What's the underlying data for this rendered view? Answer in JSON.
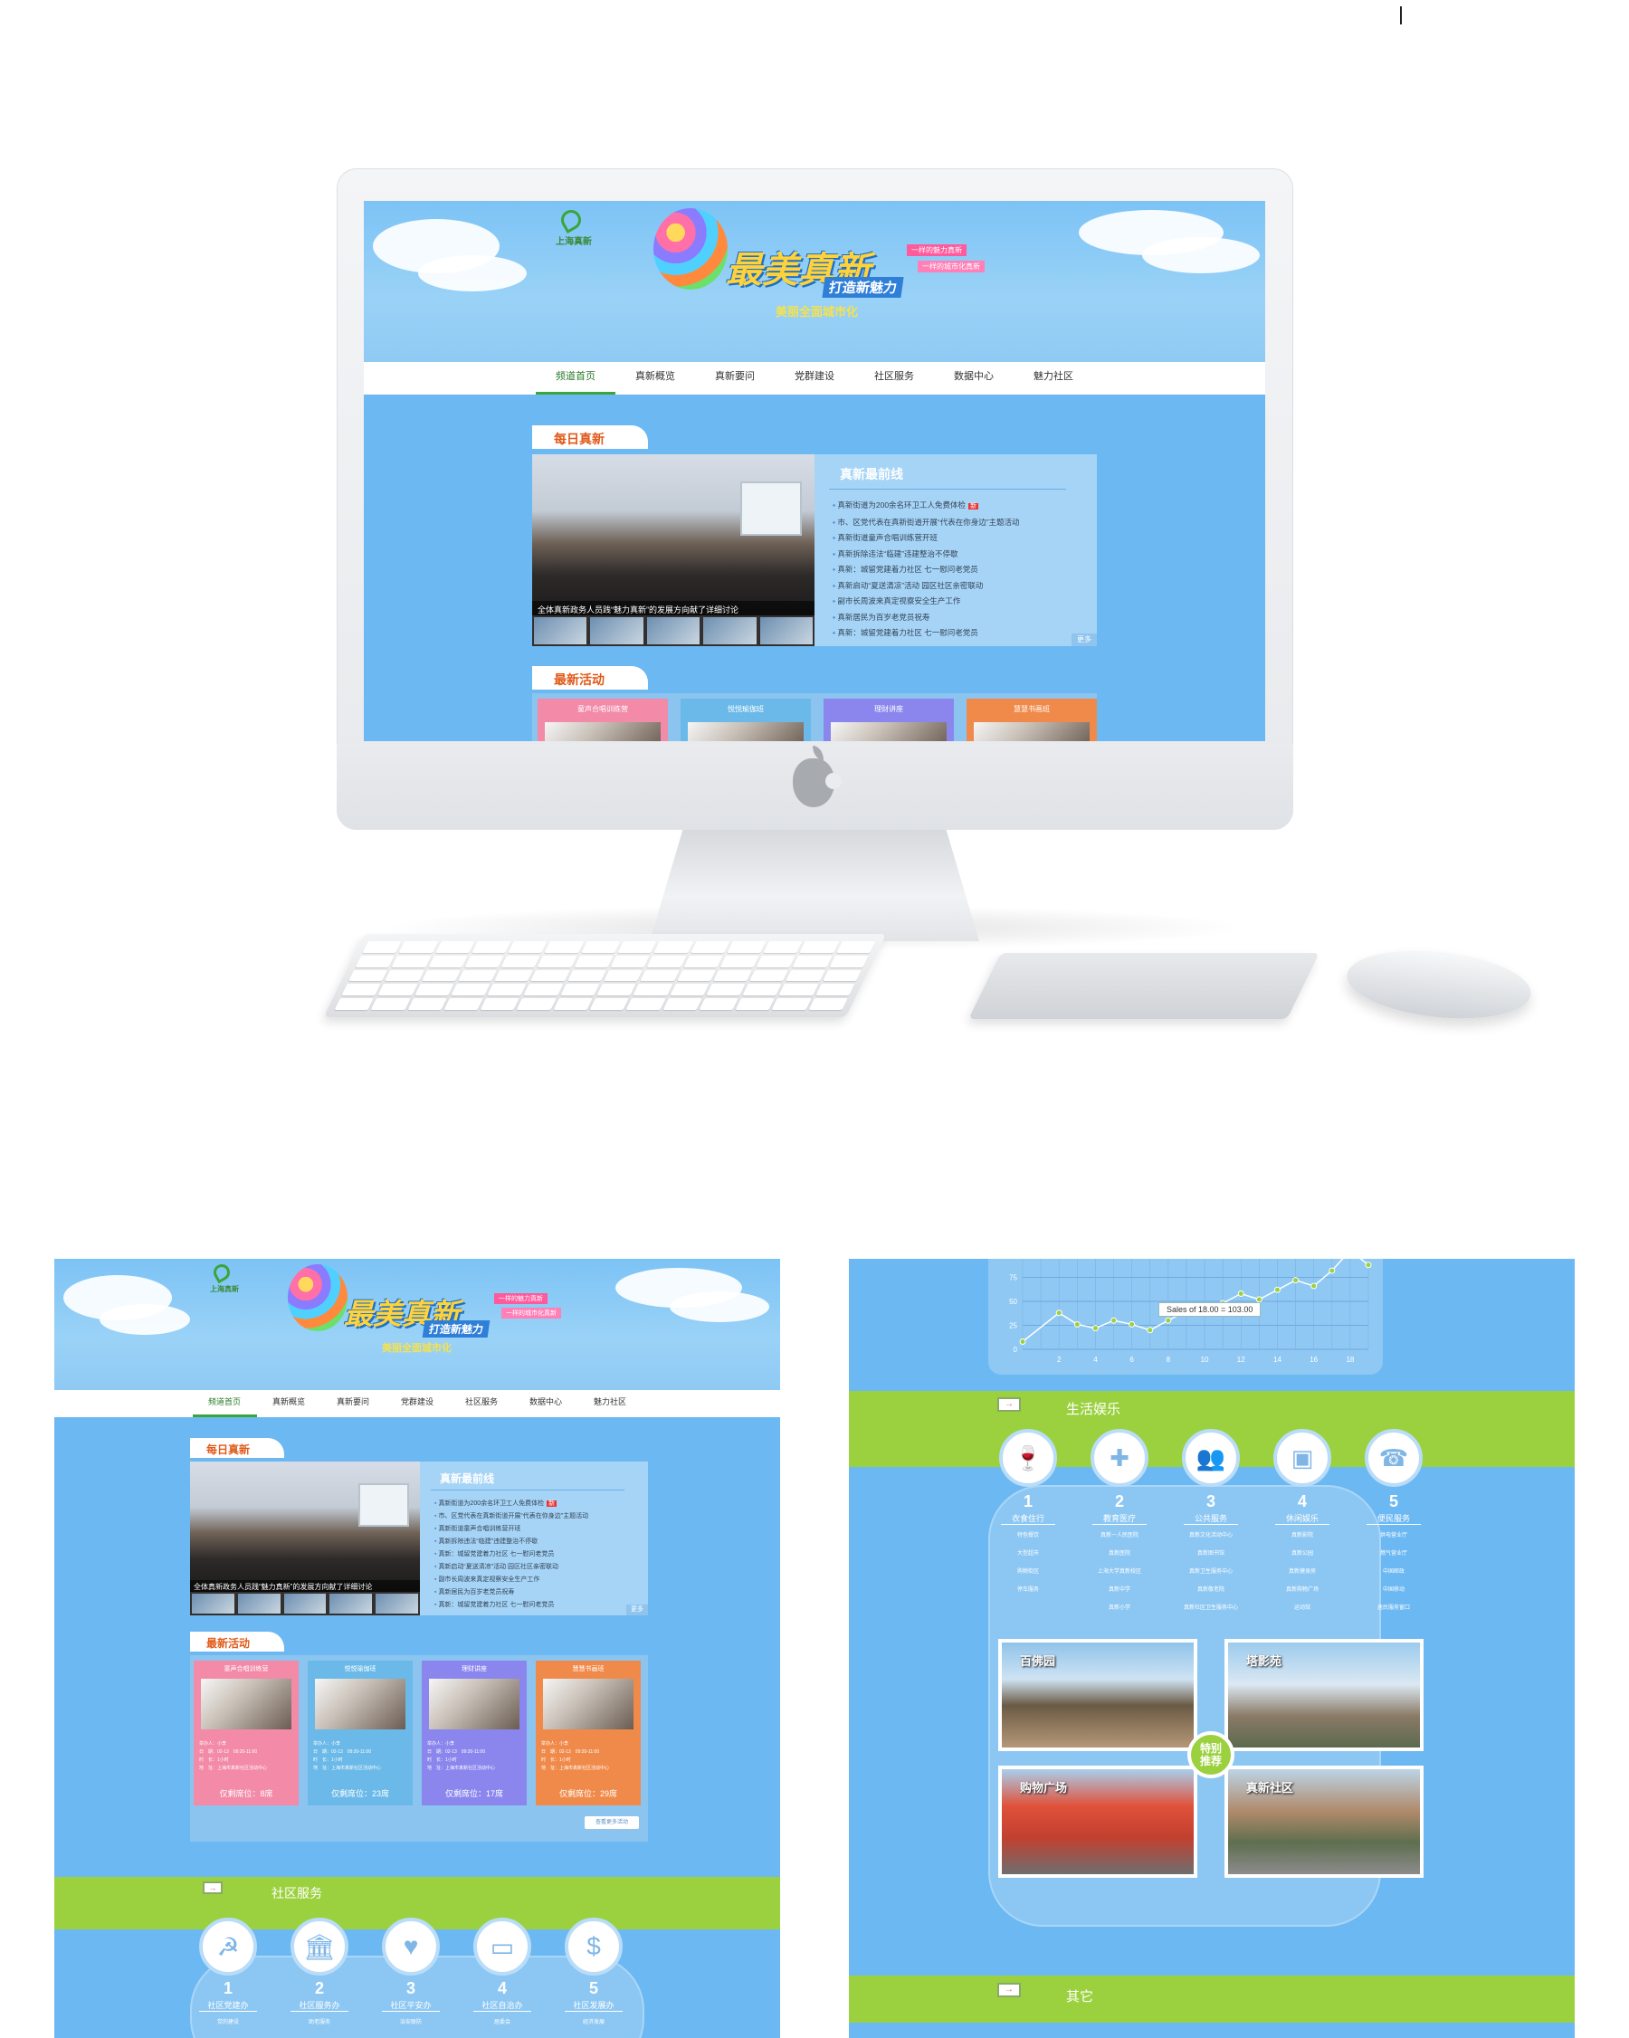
{
  "nav": [
    "频道首页",
    "真新概览",
    "真新要问",
    "党群建设",
    "社区服务",
    "数据中心",
    "魅力社区"
  ],
  "banner": {
    "logo_text": "上海真新",
    "logo_sub": "ZHENXIN",
    "title_main": "最美真新",
    "title_sub": "打造新魅力",
    "tag1": "一样的魅力真新",
    "tag2": "一样的城市化真新",
    "slogan": "美丽全面城市化"
  },
  "daily": {
    "label": "每日真新",
    "caption": "全体真新政务人员践“魅力真新”的发展方向献了详细讨论",
    "news_title": "真新最前线",
    "news": [
      "真新街道为200余名环卫工人免费体检",
      "市、区党代表在真新街道开展“代表在你身边”主题活动",
      "真新街道童声合唱训练营开班",
      "真新拆除违法“临建”违建整治不停歇",
      "真新：城留党建着力社区 七一慰问老党员",
      "真新启动“夏送清凉”活动 园区社区亲密联动",
      "副市长周波来真定视察安全生产工作",
      "真新居民为百岁老党员祝寿",
      "真新：城留党建着力社区 七一慰问老党员"
    ],
    "new_badge": "新",
    "more": "更多"
  },
  "activities": {
    "label": "最新活动",
    "cards": [
      {
        "title": "童声合唱训练营",
        "seats": "仅剩席位：8席",
        "color": "#f28aa8"
      },
      {
        "title": "悦悦瑜伽班",
        "seats": "仅剩席位：23席",
        "color": "#6ab9e8"
      },
      {
        "title": "理财讲座",
        "seats": "仅剩席位：17席",
        "color": "#8a86ee"
      },
      {
        "title": "慧慧书画班",
        "seats": "仅剩席位：29席",
        "color": "#f08a4a"
      }
    ],
    "info_lines": [
      "举办人：小李",
      "日　期：02-13　09:20-11:00",
      "时　长：1小时",
      "地　址：上海市真新社区活动中心"
    ],
    "more_btn": "查看更多活动"
  },
  "community": {
    "label": "社区服务",
    "items": [
      {
        "num": "1",
        "label": "社区党建办",
        "icon": "party-icon",
        "link": "党的建设"
      },
      {
        "num": "2",
        "label": "社区服务办",
        "icon": "bank-icon",
        "link": "助老服务"
      },
      {
        "num": "3",
        "label": "社区平安办",
        "icon": "heart-icon",
        "link": "治安联防"
      },
      {
        "num": "4",
        "label": "社区自治办",
        "icon": "sofa-icon",
        "link": "居委会"
      },
      {
        "num": "5",
        "label": "社区发展办",
        "icon": "money-icon",
        "link": "经济发展"
      }
    ]
  },
  "chart": {
    "tooltip": "Sales of 18.00 = 103.00",
    "y_ticks": [
      "100",
      "75",
      "50",
      "25",
      "0"
    ],
    "x_ticks": [
      "2",
      "4",
      "6",
      "8",
      "10",
      "12",
      "14",
      "16",
      "18"
    ]
  },
  "chart_data": {
    "type": "line",
    "x": [
      0,
      2,
      3,
      4,
      5,
      6,
      7,
      8,
      9,
      10,
      11,
      12,
      13,
      14,
      15,
      16,
      17,
      18,
      19
    ],
    "series": [
      {
        "values": [
          8,
          38,
          26,
          22,
          30,
          26,
          20,
          30,
          40,
          38,
          48,
          58,
          52,
          62,
          72,
          66,
          82,
          103,
          88
        ]
      }
    ],
    "ylim": [
      0,
      100
    ],
    "grid": true
  },
  "life": {
    "label": "生活娱乐",
    "categories": [
      {
        "num": "1",
        "label": "衣食住行",
        "icon": "wineglass-icon",
        "links": [
          "特色餐饮",
          "大型超市",
          "购物街区",
          "停车服务"
        ]
      },
      {
        "num": "2",
        "label": "教育医疗",
        "icon": "medkit-icon",
        "links": [
          "真新一人民医院",
          "真新医院",
          "上海大学真新校区",
          "真新中学",
          "真新小学"
        ]
      },
      {
        "num": "3",
        "label": "公共服务",
        "icon": "people-icon",
        "links": [
          "真新文化活动中心",
          "真新图书馆",
          "真新卫生服务中心",
          "真新敬老院",
          "真新社区卫生服务中心"
        ]
      },
      {
        "num": "4",
        "label": "休闲娱乐",
        "icon": "tv-icon",
        "links": [
          "真新影院",
          "真新公园",
          "真新健身房",
          "真新购物广场",
          "运动馆"
        ]
      },
      {
        "num": "5",
        "label": "便民服务",
        "icon": "phone-icon",
        "links": [
          "供电营业厅",
          "燃气营业厅",
          "中国邮政",
          "中国移动",
          "居民服务窗口"
        ]
      }
    ],
    "places": [
      "百佛园",
      "塔影苑",
      "购物广场",
      "真新社区"
    ],
    "recommend": "特别推荐"
  },
  "other": {
    "label": "其它"
  }
}
